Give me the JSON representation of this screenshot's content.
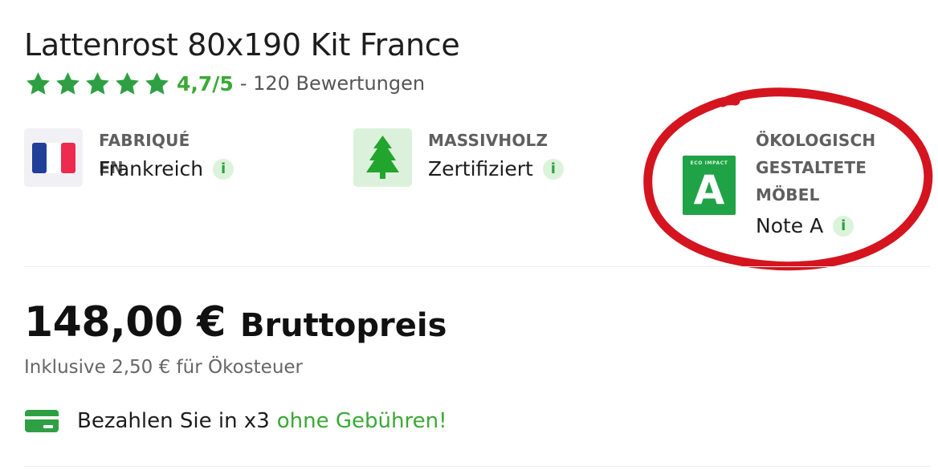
{
  "product": {
    "title": "Lattenrost 80x190 Kit France",
    "rating": {
      "stars": 5,
      "score": "4,7/5",
      "reviews": "- 120 Bewertungen"
    }
  },
  "features": [
    {
      "label_lines": [
        "FABRIQUÉ EN"
      ],
      "value": "Frankreich",
      "icon": "french-flag-icon"
    },
    {
      "label_lines": [
        "MASSIVHOLZ"
      ],
      "value": "Zertifiziert",
      "icon": "tree-icon"
    },
    {
      "label_lines": [
        "ÖKOLOGISCH",
        "GESTALTETE",
        "MÖBEL"
      ],
      "value": "Note A",
      "icon": "eco-impact-badge-icon",
      "badge": {
        "header": "ECO IMPACT",
        "grade": "A"
      }
    }
  ],
  "info_symbol": "i",
  "price": {
    "amount": "148,00 €",
    "note": "Bruttopreis",
    "tax": "Inklusive 2,50 € für Ökosteuer"
  },
  "payment": {
    "text": "Bezahlen Sie in x3",
    "highlight": "ohne Gebühren!",
    "icon": "credit-card-icon"
  },
  "colors": {
    "accent_green": "#3aa935",
    "star_green": "#2ea043",
    "badge_green": "#1fa346",
    "annotation_red": "#d4141f"
  }
}
